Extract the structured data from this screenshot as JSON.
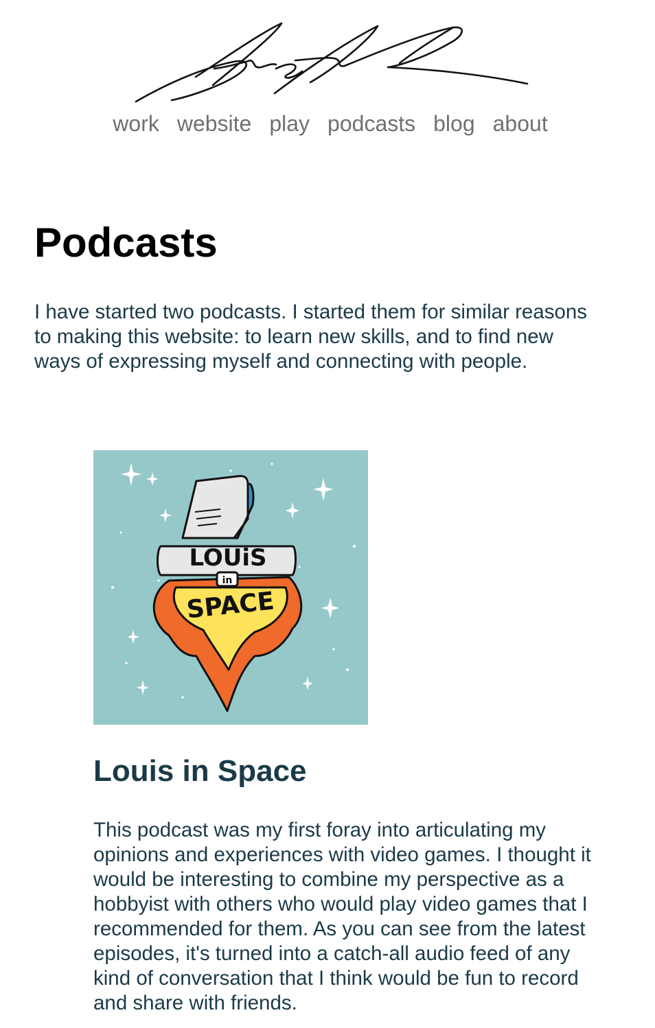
{
  "header": {
    "logo_alt": "signature logo",
    "nav": [
      {
        "label": "work"
      },
      {
        "label": "website"
      },
      {
        "label": "play"
      },
      {
        "label": "podcasts"
      },
      {
        "label": "blog"
      },
      {
        "label": "about"
      }
    ]
  },
  "main": {
    "title": "Podcasts",
    "intro": "I have started two podcasts. I started them for similar reasons to making this website: to learn new skills, and to find new ways of expressing myself and connecting with people.",
    "podcasts": [
      {
        "cover_logo_text": "LOUiS in SPACE",
        "title": "Louis in Space",
        "description": "This podcast was my first foray into articulating my opinions and experiences with video games. I thought it would be interesting to combine my perspective as a hobbyist with others who would play video games that I recommended for them. As you can see from the latest episodes, it's turned into a catch-all audio feed of any kind of conversation that I think would be fun to record and share with friends."
      }
    ]
  },
  "colors": {
    "nav_text": "#707070",
    "body_text": "#1b3a47",
    "title_text": "#000000",
    "cover_bg": "#97c8c9",
    "flame_orange": "#f06a2c",
    "flame_yellow": "#fde35c"
  }
}
